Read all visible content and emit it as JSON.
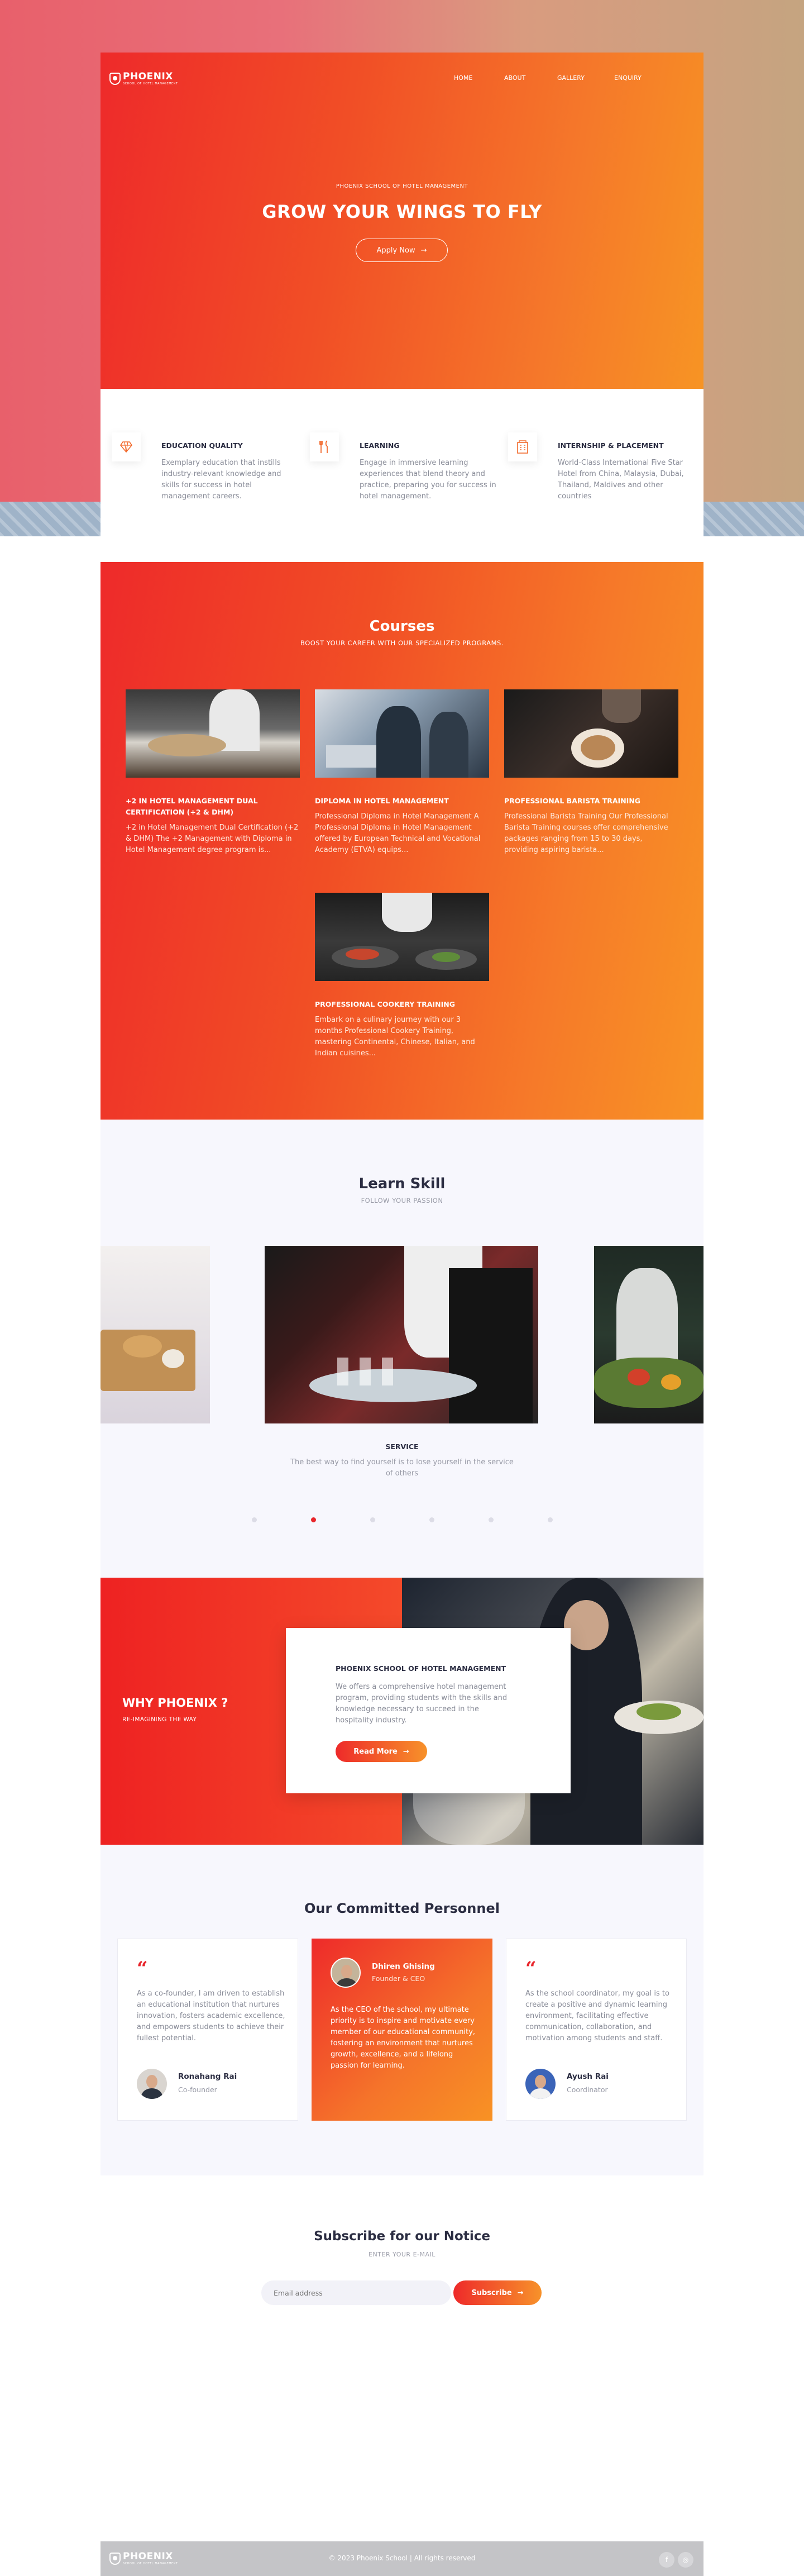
{
  "brand": {
    "name": "PHOENIX",
    "tagline": "SCHOOL OF HOTEL MANAGEMENT"
  },
  "nav": [
    {
      "label": "HOME"
    },
    {
      "label": "ABOUT"
    },
    {
      "label": "GALLERY"
    },
    {
      "label": "ENQUIRY"
    }
  ],
  "hero": {
    "eyebrow": "PHOENIX SCHOOL OF HOTEL MANAGEMENT",
    "title": "GROW YOUR WINGS TO FLY",
    "cta": "Apply Now",
    "cta_arrow": "→"
  },
  "features": [
    {
      "title": "EDUCATION QUALITY",
      "text": "Exemplary education that instills industry-relevant knowledge and skills for success in hotel management careers.",
      "icon": "diamond-icon"
    },
    {
      "title": "LEARNING",
      "text": "Engage in immersive learning experiences that blend theory and practice, preparing you for success in hotel management.",
      "icon": "utensils-icon"
    },
    {
      "title": "INTERNSHIP & PLACEMENT",
      "text": "World-Class International Five Star Hotel from China, Malaysia, Dubai, Thailand, Maldives and other countries",
      "icon": "building-icon"
    }
  ],
  "courses": {
    "title": "Courses",
    "subtitle": "BOOST YOUR CAREER WITH OUR SPECIALIZED PROGRAMS.",
    "items": [
      {
        "title": "+2 IN HOTEL MANAGEMENT DUAL CERTIFICATION (+2 & DHM)",
        "text": "+2 in Hotel Management Dual Certification (+2 & DHM) The +2 Management with Diploma in Hotel Management degree program is..."
      },
      {
        "title": "DIPLOMA IN HOTEL MANAGEMENT",
        "text": "Professional Diploma in Hotel Management A Professional Diploma in Hotel Management offered by European Technical and Vocational Academy (ETVA) equips..."
      },
      {
        "title": "PROFESSIONAL BARISTA TRAINING",
        "text": "Professional Barista Training Our Professional Barista Training courses offer comprehensive packages ranging from 15 to 30 days, providing aspiring barista..."
      },
      {
        "title": "PROFESSIONAL COOKERY TRAINING",
        "text": "Embark on a culinary journey with our 3 months Professional Cookery Training, mastering Continental, Chinese, Italian, and Indian cuisines..."
      }
    ]
  },
  "learn": {
    "title": "Learn Skill",
    "subtitle": "FOLLOW YOUR PASSION",
    "slide_title": "SERVICE",
    "slide_text": "The best way to find yourself is to lose yourself in the service of others",
    "active_dot": 1,
    "dot_count": 6
  },
  "why": {
    "title": "WHY PHOENIX ?",
    "subtitle": "RE-IMAGINING THE WAY",
    "card_title": "PHOENIX SCHOOL OF HOTEL MANAGEMENT",
    "card_text": "We offers a comprehensive hotel management program, providing students with the skills and knowledge necessary to succeed in the hospitality industry.",
    "cta": "Read More",
    "cta_arrow": "→"
  },
  "team": {
    "title": "Our Committed Personnel",
    "members": [
      {
        "quote_mark": "“",
        "text": "As a co-founder, I am driven to establish an educational institution that nurtures innovation, fosters academic excellence, and empowers students to achieve their fullest potential.",
        "name": "Ronahang Rai",
        "role": "Co-founder"
      },
      {
        "quote_mark": "“",
        "text": "As the CEO of the school, my ultimate priority is to inspire and motivate every member of our educational community, fostering an environment that nurtures growth, excellence, and a lifelong passion for learning.",
        "name": "Dhiren Ghising",
        "role": "Founder & CEO"
      },
      {
        "quote_mark": "“",
        "text": "As the school coordinator, my goal is to create a positive and dynamic learning environment, facilitating effective communication, collaboration, and motivation among students and staff.",
        "name": "Ayush Rai",
        "role": "Coordinator"
      }
    ]
  },
  "subscribe": {
    "title": "Subscribe for our Notice",
    "subtitle": "ENTER YOUR E-MAIL",
    "placeholder": "Email address",
    "button": "Subscribe",
    "button_arrow": "→"
  },
  "footer": {
    "copyright": "© 2023 Phoenix School | All rights reserved",
    "social": [
      {
        "glyph": "f",
        "icon": "facebook-icon"
      },
      {
        "glyph": "◎",
        "icon": "instagram-icon"
      }
    ]
  },
  "colors": {
    "primary_red": "#ee2a2a",
    "primary_orange": "#f7922a",
    "dark_text": "#2b2d42",
    "muted_text": "#8a8d99"
  }
}
